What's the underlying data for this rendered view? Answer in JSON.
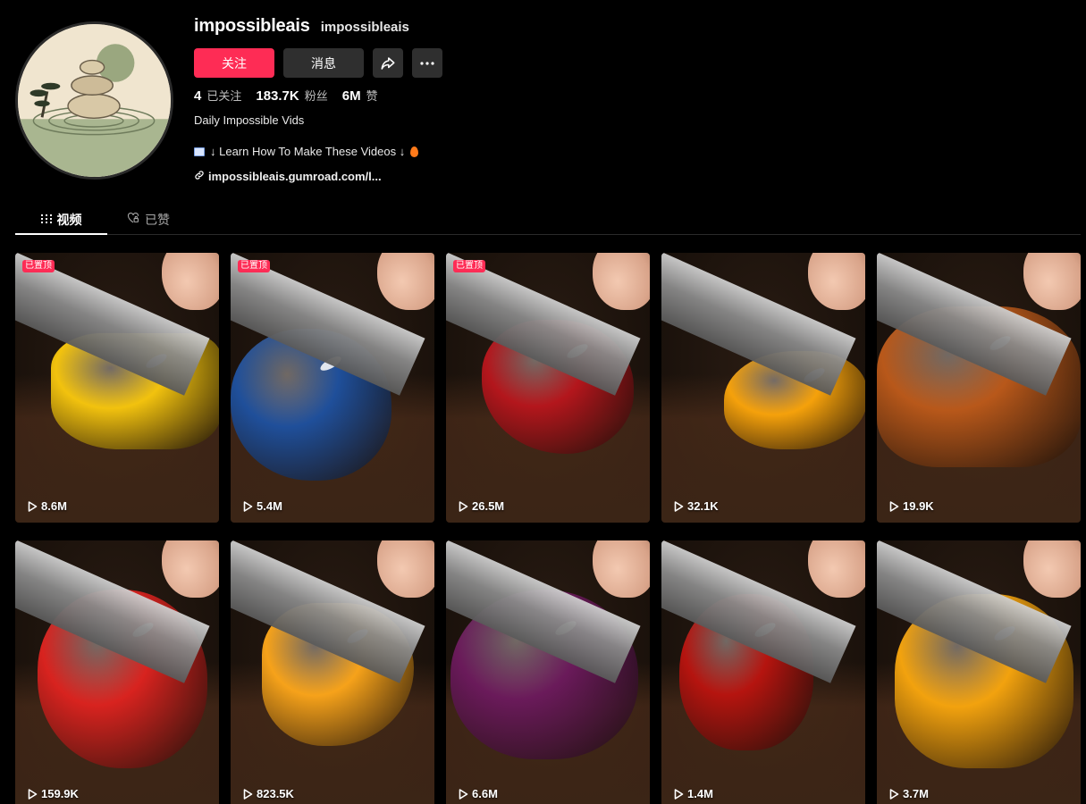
{
  "profile": {
    "username": "impossibleais",
    "nickname": "impossibleais",
    "follow_label": "关注",
    "message_label": "消息",
    "share_icon": "share-icon",
    "more_icon": "more-icon",
    "stats": [
      {
        "value": "4",
        "label": "已关注"
      },
      {
        "value": "183.7K",
        "label": "粉丝"
      },
      {
        "value": "6M",
        "label": "赞"
      }
    ],
    "bio_line1": "Daily Impossible Vids",
    "bio_line2": "↓ Learn How To Make These Videos ↓",
    "link": "impossibleais.gumroad.com/l..."
  },
  "tabs": [
    {
      "label": "视频",
      "icon": "grid-icon",
      "active": true
    },
    {
      "label": "已赞",
      "icon": "heart-lock-icon",
      "active": false
    }
  ],
  "pinned_label": "已置顶",
  "videos": [
    {
      "views": "8.6M",
      "pinned": true,
      "subject": "yellow fruit",
      "color": "#f2c20e"
    },
    {
      "views": "5.4M",
      "pinned": true,
      "subject": "blue blackberry",
      "color": "#1f4f9a"
    },
    {
      "views": "26.5M",
      "pinned": true,
      "subject": "red strawberry",
      "color": "#b3161c"
    },
    {
      "views": "32.1K",
      "pinned": false,
      "subject": "orange raspberry",
      "color": "#f5a10b"
    },
    {
      "views": "19.9K",
      "pinned": false,
      "subject": "glazed pastry",
      "color": "#b8581a"
    },
    {
      "views": "159.9K",
      "pinned": false,
      "subject": "red pomegranate",
      "color": "#d8231f"
    },
    {
      "views": "823.5K",
      "pinned": false,
      "subject": "orange strawberry",
      "color": "#f6a21a"
    },
    {
      "views": "6.6M",
      "pinned": false,
      "subject": "purple onion",
      "color": "#6a1a5a"
    },
    {
      "views": "1.4M",
      "pinned": false,
      "subject": "red apple",
      "color": "#b5140f"
    },
    {
      "views": "3.7M",
      "pinned": false,
      "subject": "amber apple",
      "color": "#f2a20e"
    }
  ]
}
